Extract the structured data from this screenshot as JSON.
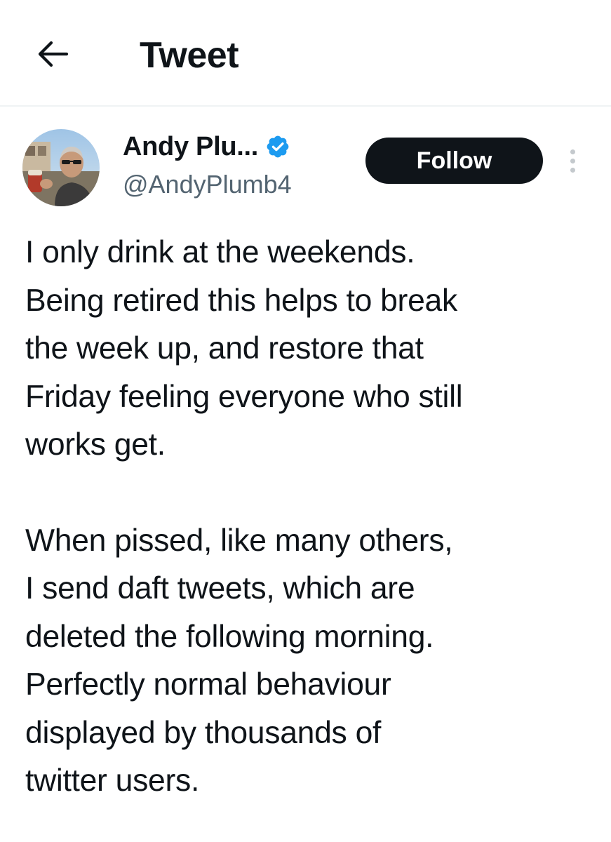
{
  "header": {
    "title": "Tweet",
    "back_icon": "arrow-left-icon"
  },
  "author": {
    "display_name": "Andy Plu...",
    "handle": "@AndyPlumb4",
    "verified": true,
    "verified_icon": "verified-badge-icon",
    "verified_color": "#1d9bf0",
    "avatar_icon": "avatar-photo"
  },
  "actions": {
    "follow_label": "Follow",
    "more_icon": "more-vertical-icon"
  },
  "tweet": {
    "paragraphs": [
      {
        "lines": [
          "I only drink at the weekends.",
          "Being retired this helps to break",
          "the week up, and restore that",
          "Friday feeling everyone who still",
          "works get."
        ]
      },
      {
        "lines": [
          "When pissed, like many others,",
          "I send daft tweets, which are",
          "deleted the following morning.",
          "Perfectly normal behaviour",
          "displayed by thousands of",
          "twitter users."
        ]
      }
    ]
  },
  "colors": {
    "text": "#0f1419",
    "secondary_text": "#536471",
    "follow_bg": "#0f1419",
    "follow_text": "#ffffff",
    "divider": "#eff3f4"
  }
}
